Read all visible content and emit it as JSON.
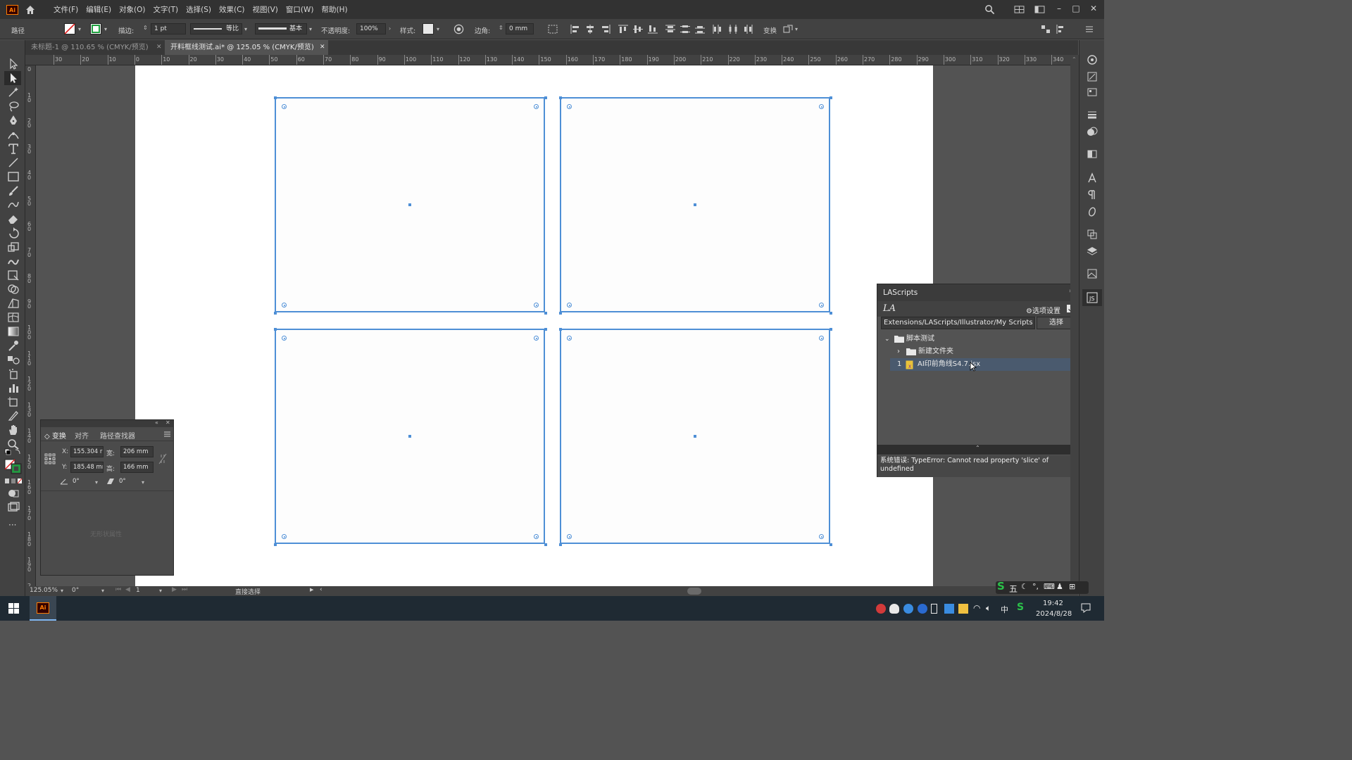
{
  "menubar": {
    "app_logo": "Ai",
    "menus": [
      "文件(F)",
      "编辑(E)",
      "对象(O)",
      "文字(T)",
      "选择(S)",
      "效果(C)",
      "视图(V)",
      "窗口(W)",
      "帮助(H)"
    ]
  },
  "control": {
    "selection_type": "路径",
    "stroke_label": "描边:",
    "stroke_weight": "1 pt",
    "stroke_profile": "等比",
    "brush": "基本",
    "opacity_label": "不透明度:",
    "opacity_value": "100%",
    "style_label": "样式:",
    "corner_label": "边角:",
    "corner_value": "0 mm",
    "transform_label": "变换"
  },
  "tabs": [
    {
      "label": "未标题-1 @ 110.65 % (CMYK/预览)",
      "active": false
    },
    {
      "label": "开料框线测试.ai* @ 125.05 % (CMYK/预览)",
      "active": true
    }
  ],
  "ruler": {
    "top_ticks": [
      "30",
      "20",
      "10",
      "0",
      "10",
      "20",
      "30",
      "40",
      "50",
      "60",
      "70",
      "80",
      "90",
      "100",
      "110",
      "120",
      "130",
      "140",
      "150",
      "160",
      "170",
      "180",
      "190",
      "200",
      "210",
      "220",
      "230",
      "240",
      "250",
      "260",
      "270",
      "280",
      "290",
      "300",
      "310",
      "320",
      "330",
      "340"
    ],
    "left_ticks": [
      "0",
      "1 0",
      "2 0",
      "3 0",
      "4 0",
      "5 0",
      "6 0",
      "7 0",
      "8 0",
      "9 0",
      "1 0 0",
      "1 1 0",
      "1 2 0",
      "1 3 0",
      "1 4 0",
      "1 5 0",
      "1 6 0",
      "1 7 0",
      "1 8 0",
      "1 9 0",
      "2 0 0"
    ]
  },
  "transform_panel": {
    "tabs": [
      "变换",
      "对齐",
      "路径查找器"
    ],
    "x_label": "X:",
    "x_value": "155.304 r",
    "y_label": "Y:",
    "y_value": "185.48 mr",
    "w_label": "宽:",
    "w_value": "206 mm",
    "h_label": "高:",
    "h_value": "166 mm",
    "angle_value": "0°",
    "shear_value": "0°",
    "footer": "无形状属性"
  },
  "lascripts": {
    "title": "LAScripts",
    "logo": "LA",
    "options_label": "选项设置",
    "path": "Extensions/LAScripts/Illustrator/My Scripts",
    "select_button": "选择",
    "tree": [
      {
        "label": "脚本测试",
        "type": "folder",
        "expanded": true
      },
      {
        "label": "新建文件夹",
        "type": "folder",
        "expanded": false
      },
      {
        "index": "1",
        "label": "AI印前角线S4.7.jsx",
        "type": "script"
      }
    ],
    "error": "系统错误: TypeError: Cannot read property 'slice' of undefined"
  },
  "statusbar": {
    "zoom": "125.05%",
    "rotation": "0°",
    "artboard": "1",
    "tool": "直接选择"
  },
  "taskbar": {
    "app": "Ai",
    "ime": "五",
    "lang": "中",
    "time": "19:42",
    "date": "2024/8/28"
  },
  "colors": {
    "selection_blue": "#4e8fd6",
    "ai_orange": "#ff7c00",
    "panel_bg": "#535353",
    "chrome_dark": "#323232"
  }
}
